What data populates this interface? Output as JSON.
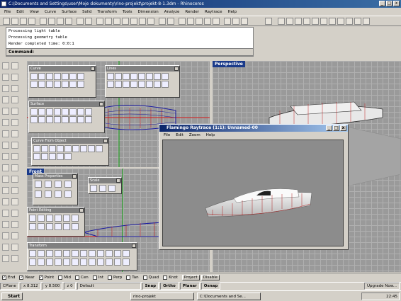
{
  "window": {
    "title": "C:\\Documents and Settings\\user\\Moje dokumenty\\rino-projekt\\projekt-8-1.3dm - Rhinoceros",
    "min_label": "_",
    "max_label": "□",
    "close_label": "x"
  },
  "menu": [
    "File",
    "Edit",
    "View",
    "Curve",
    "Surface",
    "Solid",
    "Transform",
    "Tools",
    "Dimension",
    "Analyze",
    "Render",
    "Raytrace",
    "Help"
  ],
  "command_history": [
    "Processing light table",
    "Processing geometry table",
    "Render completed time: 0:0:1"
  ],
  "command_prompt": "Command:",
  "viewports": {
    "perspective_label": "Perspective",
    "front_label": "Front"
  },
  "palettes": {
    "curve": "Curve",
    "lines": "Lines",
    "surface": "Surface",
    "curve_from_object": "Curve From Object",
    "mass_properties": "Mass Properties",
    "scale": "Scale",
    "point_editing": "Point Editing",
    "transform": "Transform"
  },
  "flamingo": {
    "title": "Flamingo Raytrace (1:1): Unnamed-00",
    "menu": [
      "File",
      "Edit",
      "Zoom",
      "Help"
    ]
  },
  "osnap": {
    "items": [
      {
        "label": "End",
        "checked": true
      },
      {
        "label": "Near",
        "checked": true
      },
      {
        "label": "Point",
        "checked": true
      },
      {
        "label": "Mid",
        "checked": false
      },
      {
        "label": "Cen",
        "checked": false
      },
      {
        "label": "Int",
        "checked": false
      },
      {
        "label": "Perp",
        "checked": false
      },
      {
        "label": "Tan",
        "checked": false
      },
      {
        "label": "Quad",
        "checked": false
      },
      {
        "label": "Knot",
        "checked": false
      }
    ],
    "project_label": "Project",
    "disable_label": "Disable"
  },
  "status": {
    "cplane": "CPlane",
    "x": "x 8.312",
    "y": "y 8.500",
    "z": "z 0",
    "layer": "Default",
    "snap": "Snap",
    "ortho": "Ortho",
    "planar": "Planar",
    "osnap": "Osnap",
    "upgrade": "Upgrade Now..."
  },
  "taskbar": {
    "start": "Start",
    "task1": "rino-projekt",
    "task2": "C:\\Documents and Se...",
    "clock": "22:45"
  },
  "colors": {
    "titlebar": "#0a246a",
    "face": "#d4d0c8",
    "viewport_bg": "#9a9a9a",
    "curve_red": "#d01010",
    "wire_blue": "#1a1aa0"
  }
}
